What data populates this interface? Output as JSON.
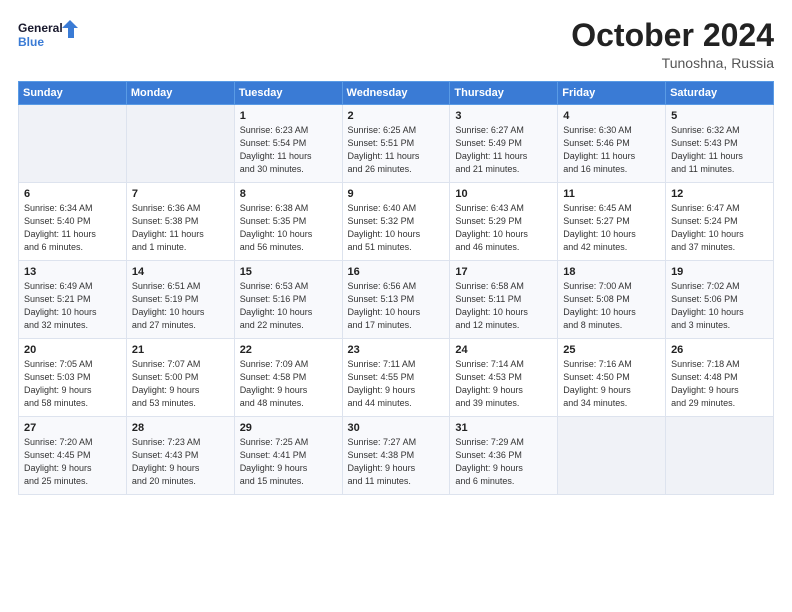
{
  "logo": {
    "line1": "General",
    "line2": "Blue"
  },
  "title": "October 2024",
  "location": "Tunoshna, Russia",
  "weekdays": [
    "Sunday",
    "Monday",
    "Tuesday",
    "Wednesday",
    "Thursday",
    "Friday",
    "Saturday"
  ],
  "weeks": [
    [
      {
        "day": "",
        "detail": ""
      },
      {
        "day": "",
        "detail": ""
      },
      {
        "day": "1",
        "detail": "Sunrise: 6:23 AM\nSunset: 5:54 PM\nDaylight: 11 hours\nand 30 minutes."
      },
      {
        "day": "2",
        "detail": "Sunrise: 6:25 AM\nSunset: 5:51 PM\nDaylight: 11 hours\nand 26 minutes."
      },
      {
        "day": "3",
        "detail": "Sunrise: 6:27 AM\nSunset: 5:49 PM\nDaylight: 11 hours\nand 21 minutes."
      },
      {
        "day": "4",
        "detail": "Sunrise: 6:30 AM\nSunset: 5:46 PM\nDaylight: 11 hours\nand 16 minutes."
      },
      {
        "day": "5",
        "detail": "Sunrise: 6:32 AM\nSunset: 5:43 PM\nDaylight: 11 hours\nand 11 minutes."
      }
    ],
    [
      {
        "day": "6",
        "detail": "Sunrise: 6:34 AM\nSunset: 5:40 PM\nDaylight: 11 hours\nand 6 minutes."
      },
      {
        "day": "7",
        "detail": "Sunrise: 6:36 AM\nSunset: 5:38 PM\nDaylight: 11 hours\nand 1 minute."
      },
      {
        "day": "8",
        "detail": "Sunrise: 6:38 AM\nSunset: 5:35 PM\nDaylight: 10 hours\nand 56 minutes."
      },
      {
        "day": "9",
        "detail": "Sunrise: 6:40 AM\nSunset: 5:32 PM\nDaylight: 10 hours\nand 51 minutes."
      },
      {
        "day": "10",
        "detail": "Sunrise: 6:43 AM\nSunset: 5:29 PM\nDaylight: 10 hours\nand 46 minutes."
      },
      {
        "day": "11",
        "detail": "Sunrise: 6:45 AM\nSunset: 5:27 PM\nDaylight: 10 hours\nand 42 minutes."
      },
      {
        "day": "12",
        "detail": "Sunrise: 6:47 AM\nSunset: 5:24 PM\nDaylight: 10 hours\nand 37 minutes."
      }
    ],
    [
      {
        "day": "13",
        "detail": "Sunrise: 6:49 AM\nSunset: 5:21 PM\nDaylight: 10 hours\nand 32 minutes."
      },
      {
        "day": "14",
        "detail": "Sunrise: 6:51 AM\nSunset: 5:19 PM\nDaylight: 10 hours\nand 27 minutes."
      },
      {
        "day": "15",
        "detail": "Sunrise: 6:53 AM\nSunset: 5:16 PM\nDaylight: 10 hours\nand 22 minutes."
      },
      {
        "day": "16",
        "detail": "Sunrise: 6:56 AM\nSunset: 5:13 PM\nDaylight: 10 hours\nand 17 minutes."
      },
      {
        "day": "17",
        "detail": "Sunrise: 6:58 AM\nSunset: 5:11 PM\nDaylight: 10 hours\nand 12 minutes."
      },
      {
        "day": "18",
        "detail": "Sunrise: 7:00 AM\nSunset: 5:08 PM\nDaylight: 10 hours\nand 8 minutes."
      },
      {
        "day": "19",
        "detail": "Sunrise: 7:02 AM\nSunset: 5:06 PM\nDaylight: 10 hours\nand 3 minutes."
      }
    ],
    [
      {
        "day": "20",
        "detail": "Sunrise: 7:05 AM\nSunset: 5:03 PM\nDaylight: 9 hours\nand 58 minutes."
      },
      {
        "day": "21",
        "detail": "Sunrise: 7:07 AM\nSunset: 5:00 PM\nDaylight: 9 hours\nand 53 minutes."
      },
      {
        "day": "22",
        "detail": "Sunrise: 7:09 AM\nSunset: 4:58 PM\nDaylight: 9 hours\nand 48 minutes."
      },
      {
        "day": "23",
        "detail": "Sunrise: 7:11 AM\nSunset: 4:55 PM\nDaylight: 9 hours\nand 44 minutes."
      },
      {
        "day": "24",
        "detail": "Sunrise: 7:14 AM\nSunset: 4:53 PM\nDaylight: 9 hours\nand 39 minutes."
      },
      {
        "day": "25",
        "detail": "Sunrise: 7:16 AM\nSunset: 4:50 PM\nDaylight: 9 hours\nand 34 minutes."
      },
      {
        "day": "26",
        "detail": "Sunrise: 7:18 AM\nSunset: 4:48 PM\nDaylight: 9 hours\nand 29 minutes."
      }
    ],
    [
      {
        "day": "27",
        "detail": "Sunrise: 7:20 AM\nSunset: 4:45 PM\nDaylight: 9 hours\nand 25 minutes."
      },
      {
        "day": "28",
        "detail": "Sunrise: 7:23 AM\nSunset: 4:43 PM\nDaylight: 9 hours\nand 20 minutes."
      },
      {
        "day": "29",
        "detail": "Sunrise: 7:25 AM\nSunset: 4:41 PM\nDaylight: 9 hours\nand 15 minutes."
      },
      {
        "day": "30",
        "detail": "Sunrise: 7:27 AM\nSunset: 4:38 PM\nDaylight: 9 hours\nand 11 minutes."
      },
      {
        "day": "31",
        "detail": "Sunrise: 7:29 AM\nSunset: 4:36 PM\nDaylight: 9 hours\nand 6 minutes."
      },
      {
        "day": "",
        "detail": ""
      },
      {
        "day": "",
        "detail": ""
      }
    ]
  ]
}
